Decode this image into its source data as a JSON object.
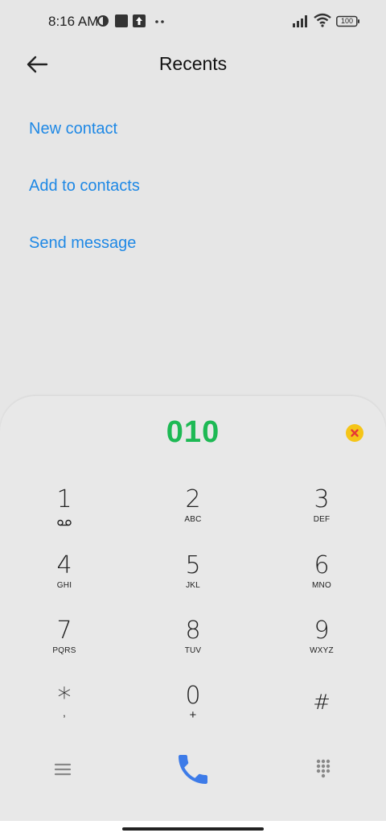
{
  "status_bar": {
    "time": "8:16 AM",
    "battery": "100",
    "icons": [
      "app-icon-c",
      "stop-square-icon",
      "upload-icon",
      "more-dots-icon",
      "signal-icon",
      "wifi-icon",
      "battery-icon"
    ]
  },
  "header": {
    "title": "Recents"
  },
  "actions": {
    "new_contact": "New contact",
    "add_to_contacts": "Add to contacts",
    "send_message": "Send message"
  },
  "dialer": {
    "number": "010",
    "keys": [
      {
        "digit": "1",
        "letters": ""
      },
      {
        "digit": "2",
        "letters": "ABC"
      },
      {
        "digit": "3",
        "letters": "DEF"
      },
      {
        "digit": "4",
        "letters": "GHI"
      },
      {
        "digit": "5",
        "letters": "JKL"
      },
      {
        "digit": "6",
        "letters": "MNO"
      },
      {
        "digit": "7",
        "letters": "PQRS"
      },
      {
        "digit": "8",
        "letters": "TUV"
      },
      {
        "digit": "9",
        "letters": "WXYZ"
      },
      {
        "digit": "*",
        "letters": ","
      },
      {
        "digit": "0",
        "letters": "+"
      },
      {
        "digit": "#",
        "letters": ""
      }
    ]
  },
  "colors": {
    "accent_blue": "#1e88e5",
    "number_green": "#1db954",
    "clear_yellow": "#f5c518",
    "call_blue": "#3d7be8"
  }
}
